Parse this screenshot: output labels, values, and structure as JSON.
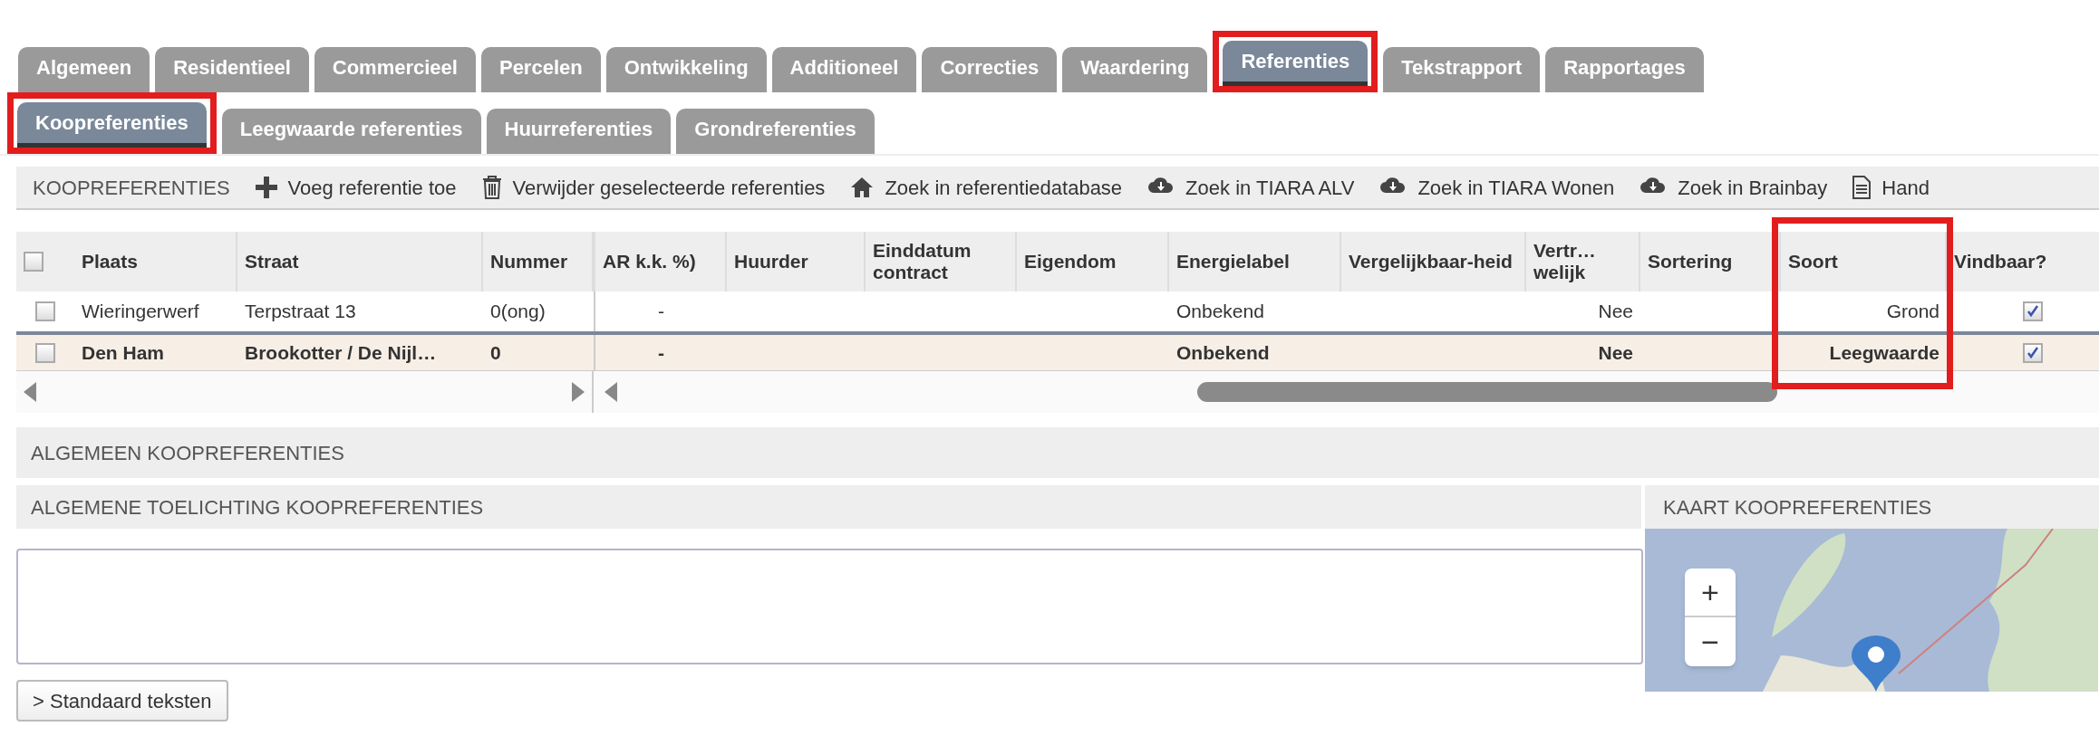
{
  "main_tabs": [
    {
      "label": "Algemeen",
      "selected": false,
      "highlighted": false
    },
    {
      "label": "Residentieel",
      "selected": false,
      "highlighted": false
    },
    {
      "label": "Commercieel",
      "selected": false,
      "highlighted": false
    },
    {
      "label": "Percelen",
      "selected": false,
      "highlighted": false
    },
    {
      "label": "Ontwikkeling",
      "selected": false,
      "highlighted": false
    },
    {
      "label": "Additioneel",
      "selected": false,
      "highlighted": false
    },
    {
      "label": "Correcties",
      "selected": false,
      "highlighted": false
    },
    {
      "label": "Waardering",
      "selected": false,
      "highlighted": false
    },
    {
      "label": "Referenties",
      "selected": true,
      "highlighted": true
    },
    {
      "label": "Tekstrapport",
      "selected": false,
      "highlighted": false
    },
    {
      "label": "Rapportages",
      "selected": false,
      "highlighted": false
    }
  ],
  "sub_tabs": [
    {
      "label": "Koopreferenties",
      "selected": true,
      "highlighted": true
    },
    {
      "label": "Leegwaarde referenties",
      "selected": false,
      "highlighted": false
    },
    {
      "label": "Huurreferenties",
      "selected": false,
      "highlighted": false
    },
    {
      "label": "Grondreferenties",
      "selected": false,
      "highlighted": false
    }
  ],
  "toolbar": {
    "title": "KOOPREFERENTIES",
    "actions": [
      {
        "kind": "add",
        "label": "Voeg referentie toe"
      },
      {
        "kind": "delete",
        "label": "Verwijder geselecteerde referenties"
      },
      {
        "kind": "home",
        "label": "Zoek in referentiedatabase"
      },
      {
        "kind": "cloud",
        "label": "Zoek in TIARA ALV"
      },
      {
        "kind": "cloud",
        "label": "Zoek in TIARA Wonen"
      },
      {
        "kind": "cloud",
        "label": "Zoek in Brainbay"
      },
      {
        "kind": "document",
        "label": "Hand"
      }
    ]
  },
  "table": {
    "select_all": {
      "checked": false
    },
    "columns": [
      {
        "label": "Plaats",
        "highlighted": false
      },
      {
        "label": "Straat",
        "highlighted": false
      },
      {
        "label": "Nummer",
        "highlighted": false
      },
      {
        "label": "AR k.k. %)",
        "highlighted": false
      },
      {
        "label": "Huurder",
        "highlighted": false
      },
      {
        "label": "Einddatum contract",
        "highlighted": false
      },
      {
        "label": "Eigendom",
        "highlighted": false
      },
      {
        "label": "Energielabel",
        "highlighted": false
      },
      {
        "label": "Vergelijkbaar-heid",
        "highlighted": false
      },
      {
        "label": "Vertr… welijk",
        "highlighted": false
      },
      {
        "label": "Sortering",
        "highlighted": false
      },
      {
        "label": "Soort",
        "highlighted": true
      },
      {
        "label": "Vindbaar?",
        "highlighted": false
      }
    ],
    "rows": [
      {
        "selected": false,
        "checked": false,
        "cells": [
          "Wieringerwerf",
          "Terpstraat 13",
          "0(ong)",
          "-",
          "",
          "",
          "",
          "Onbekend",
          "",
          "Nee",
          "",
          "Grond"
        ],
        "vindbaar": true
      },
      {
        "selected": true,
        "checked": false,
        "cells": [
          "Den Ham",
          "Brookotter / De Nijl…",
          "0",
          "-",
          "",
          "",
          "",
          "Onbekend",
          "",
          "Nee",
          "",
          "Leegwaarde"
        ],
        "vindbaar": true
      }
    ]
  },
  "general_section": {
    "title": "ALGEMEEN KOOPREFERENTIES"
  },
  "explanation": {
    "title": "ALGEMENE TOELICHTING KOOPREFERENTIES",
    "button": "> Standaard teksten"
  },
  "map": {
    "title": "KAART KOOPREFERENTIES",
    "zoom_in": "+",
    "zoom_out": "−"
  }
}
